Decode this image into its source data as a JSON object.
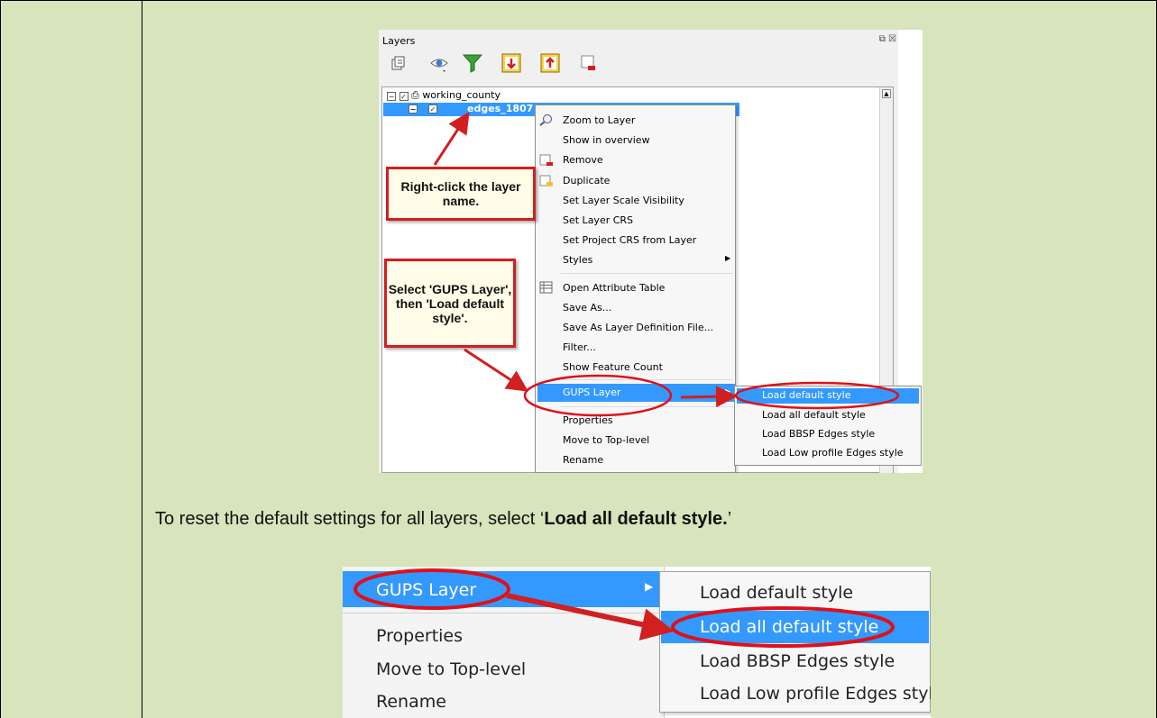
{
  "screenshot1": {
    "panel_title": "Layers",
    "panel_controls": "⧉ ☒",
    "layer_tree": {
      "group_name": "working_county",
      "selected_layer": "edges_1807"
    },
    "context_menu": {
      "items": [
        "Zoom to Layer",
        "Show in overview",
        "Remove",
        "Duplicate",
        "Set Layer Scale Visibility",
        "Set Layer CRS",
        "Set Project CRS from Layer",
        "Styles",
        "Open Attribute Table",
        "Save As...",
        "Save As Layer Definition File...",
        "Filter...",
        "Show Feature Count",
        "GUPS Layer",
        "Properties",
        "Move to Top-level",
        "Rename"
      ]
    },
    "submenu": {
      "items": [
        "Load default style",
        "Load all default style",
        "Load BBSP Edges style",
        "Load Low profile Edges style"
      ]
    },
    "callouts": {
      "right_click": "Right-click the layer name.",
      "select_gups": "Select 'GUPS Layer', then 'Load default style'."
    }
  },
  "instruction": {
    "before": "To reset the default settings for all layers, select ‘",
    "bold": "Load all default style.",
    "after": "’"
  },
  "screenshot2": {
    "menu_items": [
      "GUPS Layer",
      "Properties",
      "Move to Top-level",
      "Rename"
    ],
    "submenu_items": [
      "Load default style",
      "Load all default style",
      "Load BBSP Edges style",
      "Load Low profile Edges style"
    ]
  },
  "colors": {
    "page_background": "#d7e4bc",
    "selection_blue": "#3399ff",
    "annotation_red": "#d21f1f"
  }
}
